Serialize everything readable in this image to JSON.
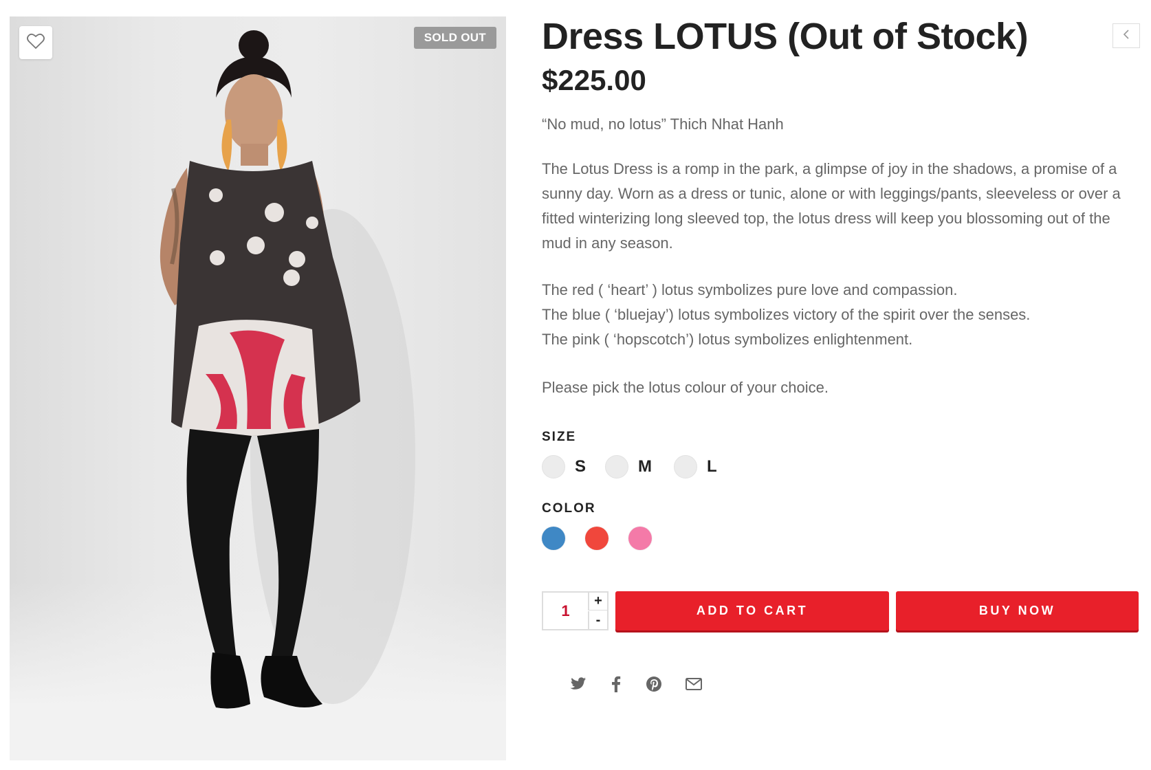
{
  "product": {
    "title": "Dress LOTUS (Out of Stock)",
    "price": "$225.00",
    "badge": "SOLD OUT",
    "image_alt": "Model wearing the Lotus dress over black leggings"
  },
  "description": {
    "quote": "“No mud, no lotus” Thich Nhat Hanh",
    "body": [
      "The Lotus Dress is a romp in the park, a glimpse of joy in the shadows, a promise of a",
      "sunny day. Worn as a dress or tunic, alone or with leggings/pants, sleeveless or over a",
      "fitted winterizing long sleeved top, the lotus dress will keep you blossoming out of the",
      "mud in any season."
    ],
    "symbolism": [
      "The red ( ‘heart’ ) lotus symbolizes pure love and compassion.",
      "The blue ( ‘bluejay’) lotus symbolizes victory of the spirit over the senses.",
      "The pink ( ‘hopscotch’) lotus symbolizes enlightenment."
    ],
    "pick": "Please pick the lotus colour of your choice."
  },
  "options": {
    "size_label": "SIZE",
    "sizes": [
      "S",
      "M",
      "L"
    ],
    "color_label": "COLOR",
    "colors": [
      {
        "name": "blue",
        "hex": "#3f88c5"
      },
      {
        "name": "red",
        "hex": "#f0473c"
      },
      {
        "name": "pink",
        "hex": "#f47aa8"
      }
    ]
  },
  "purchase": {
    "quantity": "1",
    "plus": "+",
    "minus": "-",
    "add_to_cart": "ADD TO CART",
    "buy_now": "BUY NOW"
  },
  "share": {
    "icons": [
      "twitter-icon",
      "facebook-icon",
      "pinterest-icon",
      "email-icon"
    ]
  },
  "colors": {
    "accent": "#e8202a",
    "badge": "#9a9a9a",
    "text_dark": "#222222",
    "text_muted": "#666666"
  }
}
